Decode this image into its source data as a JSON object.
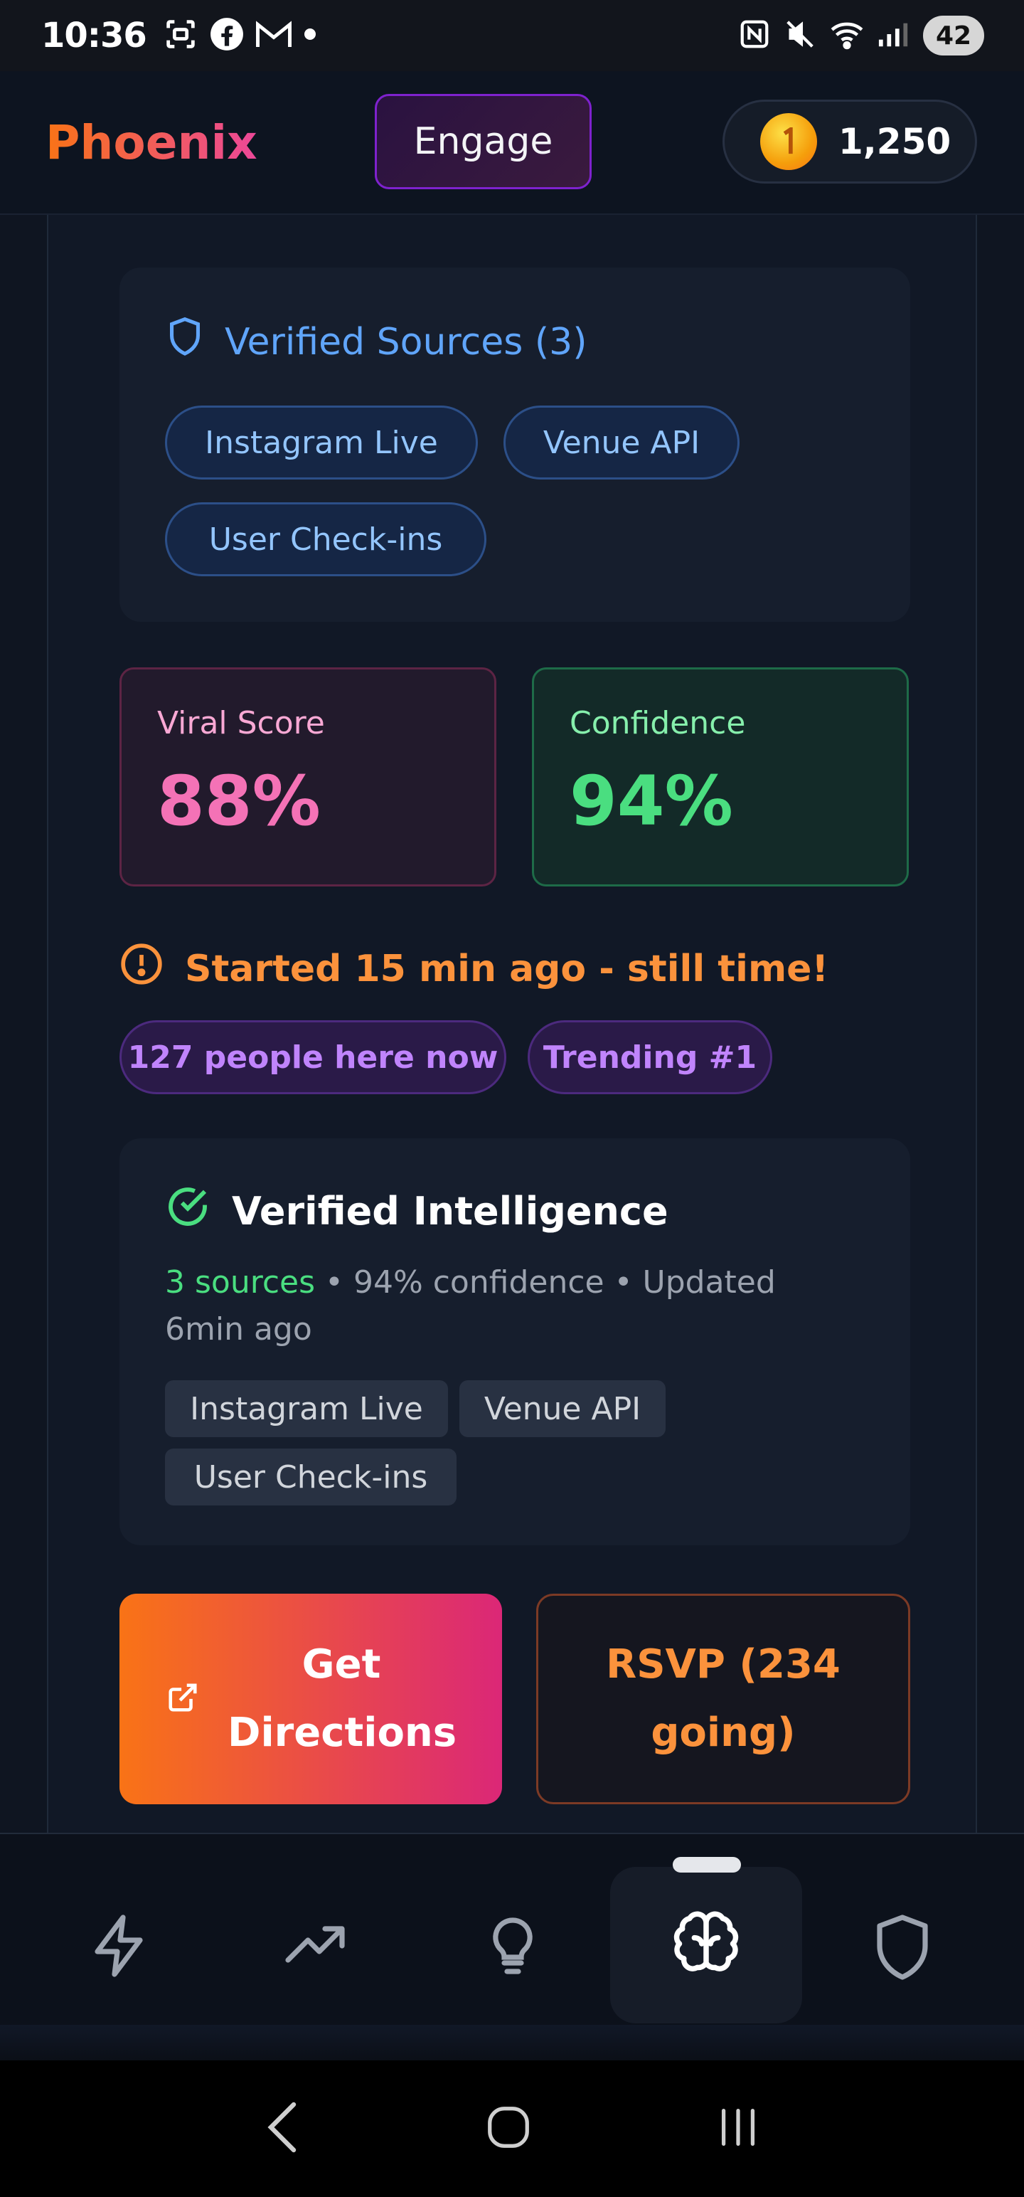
{
  "status_bar": {
    "time": "10:36",
    "battery": "42",
    "left_icons": [
      "screenshot-icon",
      "facebook-icon",
      "gmail-icon",
      "dot-icon"
    ],
    "right_icons": [
      "nfc-icon",
      "mute-icon",
      "wifi-icon",
      "signal-icon"
    ]
  },
  "header": {
    "brand": "Phoenix",
    "engage_label": "Engage",
    "coin_balance": "1,250"
  },
  "sources": {
    "title": "Verified Sources (3)",
    "chips": [
      "Instagram Live",
      "Venue API",
      "User Check-ins"
    ]
  },
  "stats": {
    "viral_label": "Viral Score",
    "viral_value": "88%",
    "confidence_label": "Confidence",
    "confidence_value": "94%",
    "colors": {
      "viral": "#f472b6",
      "confidence": "#4ade80"
    }
  },
  "status": {
    "started_text": "Started 15 min ago - still time!",
    "chips": [
      "127 people here now",
      "Trending #1"
    ]
  },
  "intelligence": {
    "title": "Verified Intelligence",
    "sources_count": "3 sources",
    "meta_rest": " • 94% confidence • Updated 6min ago",
    "tags": [
      "Instagram Live",
      "Venue API",
      "User Check-ins"
    ]
  },
  "actions": {
    "directions_label": "Get Directions",
    "rsvp_label": "RSVP (234 going)"
  },
  "bottom_nav": {
    "items": [
      "lightning-icon",
      "trending-icon",
      "lightbulb-icon",
      "brain-icon",
      "shield-icon"
    ],
    "active_index": 3
  },
  "system_nav": [
    "back-icon",
    "home-icon",
    "recents-icon"
  ]
}
